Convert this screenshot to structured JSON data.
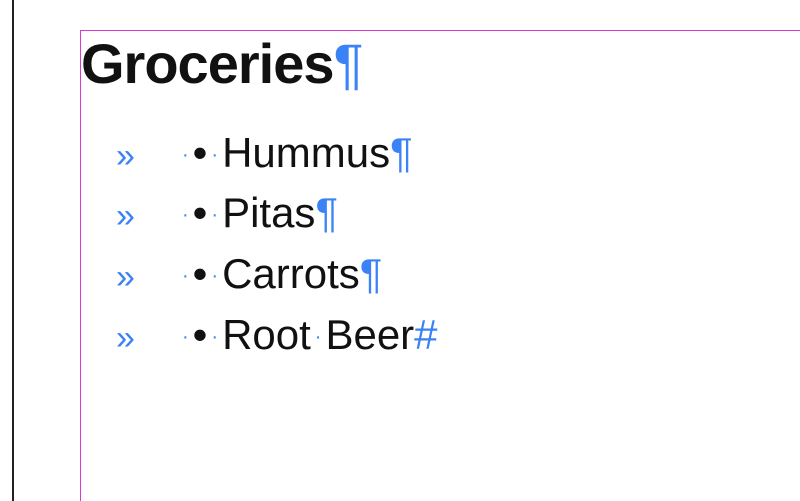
{
  "heading": "Groceries",
  "marks": {
    "pilcrow": "¶",
    "indent": "»",
    "tab_dot": "·",
    "space_dot": "·",
    "bullet": "•",
    "end": "#"
  },
  "items": [
    {
      "text": "Hummus",
      "end": "pilcrow",
      "words": [
        "Hummus"
      ]
    },
    {
      "text": "Pitas",
      "end": "pilcrow",
      "words": [
        "Pitas"
      ]
    },
    {
      "text": "Carrots",
      "end": "pilcrow",
      "words": [
        "Carrots"
      ]
    },
    {
      "text": "Root Beer",
      "end": "end",
      "words": [
        "Root",
        "Beer"
      ]
    }
  ]
}
